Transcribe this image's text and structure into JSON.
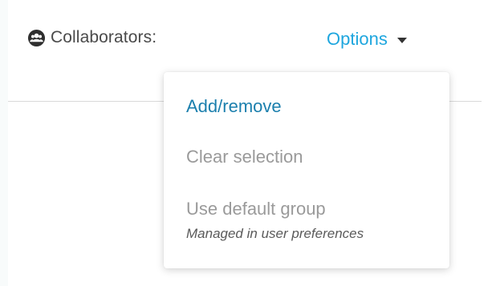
{
  "header": {
    "collaborators_label": "Collaborators:",
    "options_label": "Options"
  },
  "menu": {
    "items": [
      {
        "label": "Add/remove"
      },
      {
        "label": "Clear selection"
      },
      {
        "label": "Use default group",
        "sublabel": "Managed in user preferences"
      }
    ]
  },
  "colors": {
    "link": "#1ea6de",
    "active_item": "#1b7fad",
    "disabled_item": "#9a9a9a"
  },
  "icons": {
    "collaborators": "group-icon",
    "options_toggle": "caret-down-icon"
  }
}
